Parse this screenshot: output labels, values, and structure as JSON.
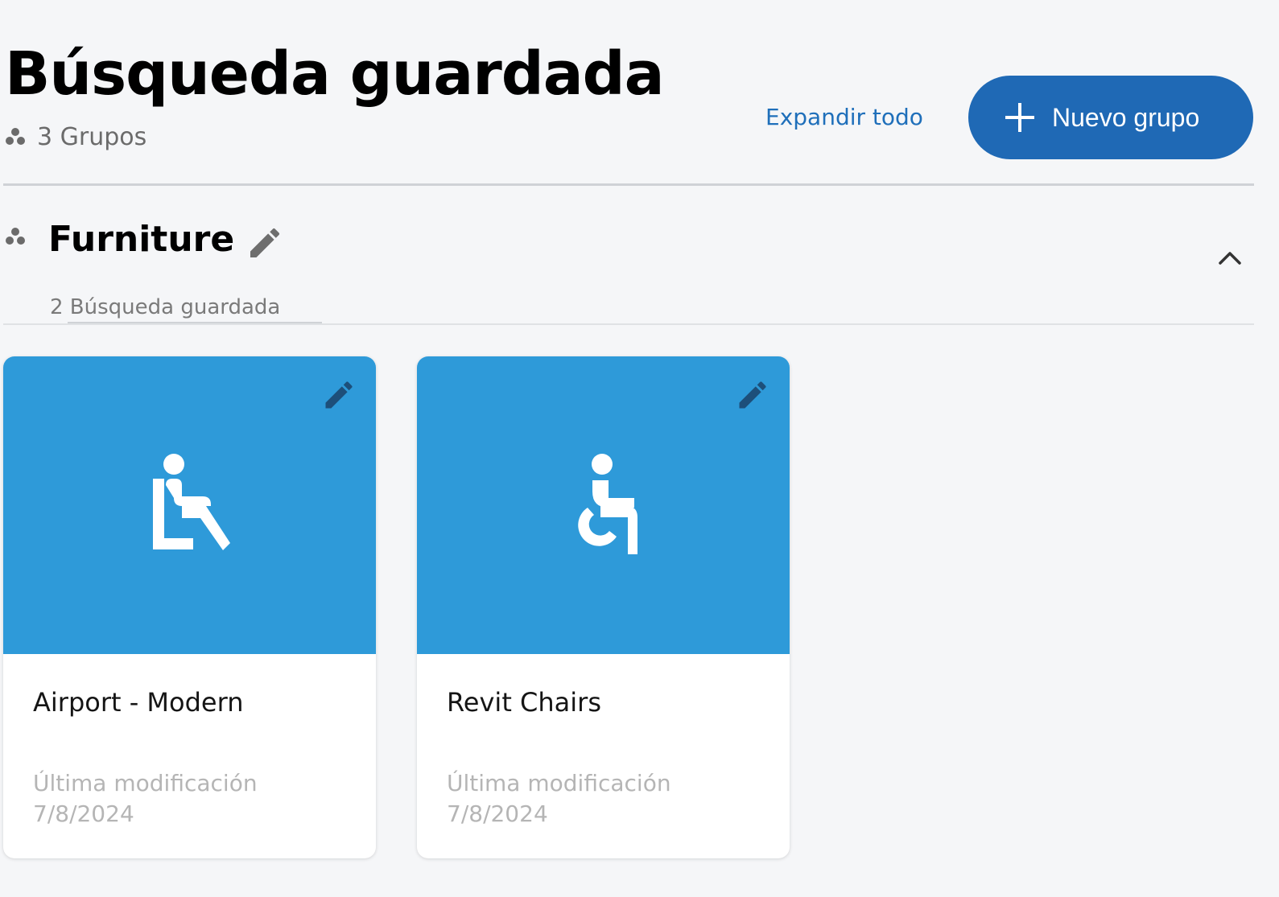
{
  "header": {
    "title": "Búsqueda guardada",
    "group_count": "3 Grupos",
    "expand_all": "Expandir todo",
    "new_group_label": "Nuevo grupo"
  },
  "group": {
    "name": "Furniture",
    "subtitle": "2 Búsqueda guardada"
  },
  "cards": [
    {
      "title": "Airport - Modern",
      "meta_label": "Última modificación",
      "meta_date": "7/8/2024",
      "icon": "seated-person-icon"
    },
    {
      "title": "Revit Chairs",
      "meta_label": "Última modificación",
      "meta_date": "7/8/2024",
      "icon": "wheelchair-icon"
    }
  ],
  "colors": {
    "background": "#f5f6f8",
    "primary_button": "#1f69b5",
    "link": "#1f6fba",
    "card_banner": "#2e9ad9"
  }
}
